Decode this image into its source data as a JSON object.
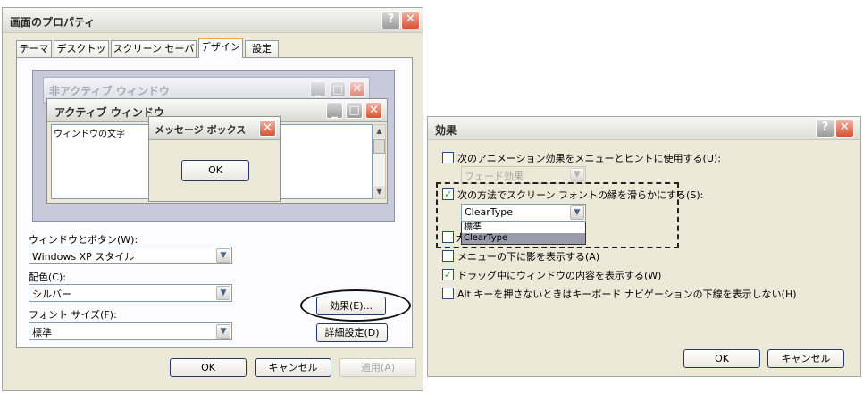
{
  "main_dialog": {
    "title": "画面のプロパティ",
    "tabs": [
      {
        "label": "テーマ"
      },
      {
        "label": "デスクトップ"
      },
      {
        "label": "スクリーン セーバー"
      },
      {
        "label": "デザイン"
      },
      {
        "label": "設定"
      }
    ],
    "preview": {
      "inactive_title": "非アクティブ ウィンドウ",
      "active_title": "アクティブ ウィンドウ",
      "window_text": "ウィンドウの文字",
      "msgbox_title": "メッセージ ボックス",
      "msgbox_ok": "OK"
    },
    "windows_buttons_label": "ウィンドウとボタン(W):",
    "windows_buttons_value": "Windows XP スタイル",
    "color_label": "配色(C):",
    "color_value": "シルバー",
    "fontsize_label": "フォント サイズ(F):",
    "fontsize_value": "標準",
    "effects_button": "効果(E)...",
    "advanced_button": "詳細設定(D)",
    "ok": "OK",
    "cancel": "キャンセル",
    "apply": "適用(A)"
  },
  "effects_dialog": {
    "title": "効果",
    "options": [
      {
        "label": "次のアニメーション効果をメニューとヒントに使用する(U):",
        "checked": false
      },
      {
        "label": "次の方法でスクリーン フォントの縁を滑らかにする(S):",
        "checked": true
      },
      {
        "label": "大",
        "checked": false
      },
      {
        "label": "メニューの下に影を表示する(A)",
        "checked": false
      },
      {
        "label": "ドラッグ中にウィンドウの内容を表示する(W)",
        "checked": true
      },
      {
        "label": "Alt キーを押さないときはキーボード ナビゲーションの下線を表示しない(H)",
        "checked": false
      }
    ],
    "animation_combo_value": "フェード効果",
    "smoothing_combo_value": "ClearType",
    "dropdown_options": [
      "標準",
      "ClearType"
    ],
    "ok": "OK",
    "cancel": "キャンセル"
  }
}
